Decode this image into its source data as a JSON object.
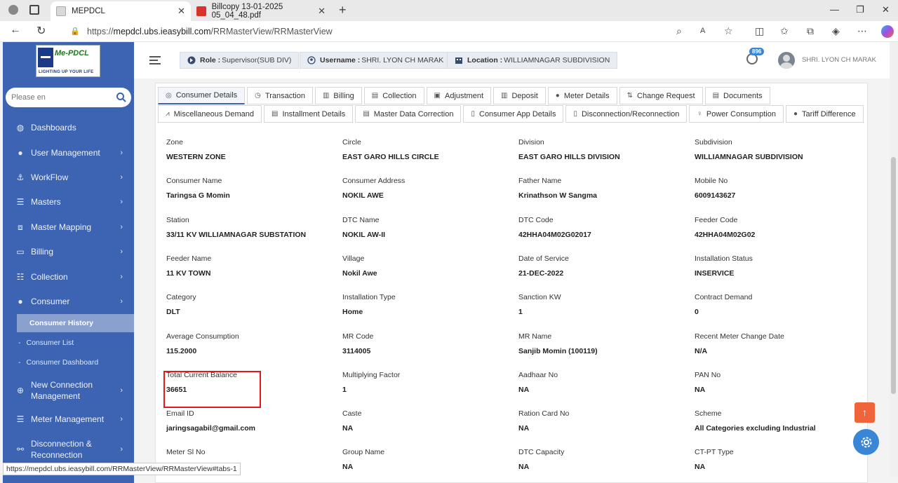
{
  "browser": {
    "tabs": [
      {
        "title": "MEPDCL",
        "active": true
      },
      {
        "title": "Billcopy 13-01-2025 05_04_48.pdf",
        "active": false
      }
    ],
    "url_prefix": "https://",
    "url_host": "mepdcl.ubs.ieasybill.com",
    "url_path": "/RRMasterView/RRMasterView",
    "status_url": "https://mepdcl.ubs.ieasybill.com/RRMasterView/RRMasterView#tabs-1"
  },
  "sidebar": {
    "logo_text": "Me-PDCL",
    "logo_sub": "LIGHTING UP YOUR LIFE",
    "search_placeholder": "Please en",
    "items": [
      {
        "label": "Dashboards",
        "icon": "dashboard-icon"
      },
      {
        "label": "User Management",
        "icon": "user-icon"
      },
      {
        "label": "WorkFlow",
        "icon": "anchor-icon"
      },
      {
        "label": "Masters",
        "icon": "list-icon"
      },
      {
        "label": "Master Mapping",
        "icon": "sitemap-icon"
      },
      {
        "label": "Billing",
        "icon": "monitor-icon"
      },
      {
        "label": "Collection",
        "icon": "list-icon"
      },
      {
        "label": "Consumer",
        "icon": "user-icon"
      }
    ],
    "consumer_sub": [
      "Consumer History",
      "Consumer List",
      "Consumer Dashboard"
    ],
    "items_after": [
      {
        "label": "New Connection Management",
        "icon": "plus-circle-icon"
      },
      {
        "label": "Meter Management",
        "icon": "list-icon"
      },
      {
        "label": "Disconnection & Reconnection",
        "icon": "link-icon"
      }
    ]
  },
  "header": {
    "role_label": "Role :",
    "role_value": "Supervisor(SUB DIV)",
    "username_label": "Username :",
    "username_value": "SHRI. LYON CH MARAK",
    "location_label": "Location :",
    "location_value": "WILLIAMNAGAR SUBDIVISION",
    "notification_count": "896",
    "user_display": "SHRI. LYON CH MARAK"
  },
  "tabs_row1": [
    "Consumer Details",
    "Transaction",
    "Billing",
    "Collection",
    "Adjustment",
    "Deposit",
    "Meter Details",
    "Change Request",
    "Documents"
  ],
  "tabs_row2": [
    "Miscellaneous Demand",
    "Installment Details",
    "Master Data Correction",
    "Consumer App Details",
    "Disconnection/Reconnection",
    "Power Consumption",
    "Tariff Difference"
  ],
  "fields": [
    [
      {
        "label": "Zone",
        "value": "WESTERN ZONE"
      },
      {
        "label": "Circle",
        "value": "EAST GARO HILLS CIRCLE"
      },
      {
        "label": "Division",
        "value": "EAST GARO HILLS DIVISION"
      },
      {
        "label": "Subdivision",
        "value": "WILLIAMNAGAR SUBDIVISION"
      }
    ],
    [
      {
        "label": "Consumer Name",
        "value": "Taringsa G Momin"
      },
      {
        "label": "Consumer Address",
        "value": "NOKIL AWE"
      },
      {
        "label": "Father Name",
        "value": "Krinathson W Sangma"
      },
      {
        "label": "Mobile No",
        "value": "6009143627"
      }
    ],
    [
      {
        "label": "Station",
        "value": "33/11 KV WILLIAMNAGAR SUBSTATION"
      },
      {
        "label": "DTC Name",
        "value": "NOKIL AW-II"
      },
      {
        "label": "DTC Code",
        "value": "42HHA04M02G02017"
      },
      {
        "label": "Feeder Code",
        "value": "42HHA04M02G02"
      }
    ],
    [
      {
        "label": "Feeder Name",
        "value": "11 KV TOWN"
      },
      {
        "label": "Village",
        "value": "Nokil Awe"
      },
      {
        "label": "Date of Service",
        "value": "21-DEC-2022"
      },
      {
        "label": "Installation Status",
        "value": "INSERVICE"
      }
    ],
    [
      {
        "label": "Category",
        "value": "DLT"
      },
      {
        "label": "Installation Type",
        "value": "Home"
      },
      {
        "label": "Sanction KW",
        "value": "1"
      },
      {
        "label": "Contract Demand",
        "value": "0"
      }
    ],
    [
      {
        "label": "Average Consumption",
        "value": "115.2000"
      },
      {
        "label": "MR Code",
        "value": "3114005"
      },
      {
        "label": "MR Name",
        "value": "Sanjib Momin (100119)"
      },
      {
        "label": "Recent Meter Change Date",
        "value": "N/A"
      }
    ],
    [
      {
        "label": "Total Current Balance",
        "value": "36651"
      },
      {
        "label": "Multiplying Factor",
        "value": "1"
      },
      {
        "label": "Aadhaar No",
        "value": "NA"
      },
      {
        "label": "PAN No",
        "value": "NA"
      }
    ],
    [
      {
        "label": "Email ID",
        "value": "jaringsagabil@gmail.com"
      },
      {
        "label": "Caste",
        "value": "NA"
      },
      {
        "label": "Ration Card No",
        "value": "NA"
      },
      {
        "label": "Scheme",
        "value": "All Categories excluding Industrial"
      }
    ],
    [
      {
        "label": "Meter Sl No",
        "value": ""
      },
      {
        "label": "Group Name",
        "value": "NA"
      },
      {
        "label": "DTC Capacity",
        "value": "NA"
      },
      {
        "label": "CT-PT Type",
        "value": "NA"
      }
    ]
  ],
  "colors": {
    "sidebar_bg": "#3d64b2",
    "highlight_box": "#e01a1a",
    "scroll_top_button": "#f0643c",
    "settings_button": "#3a86d6"
  }
}
